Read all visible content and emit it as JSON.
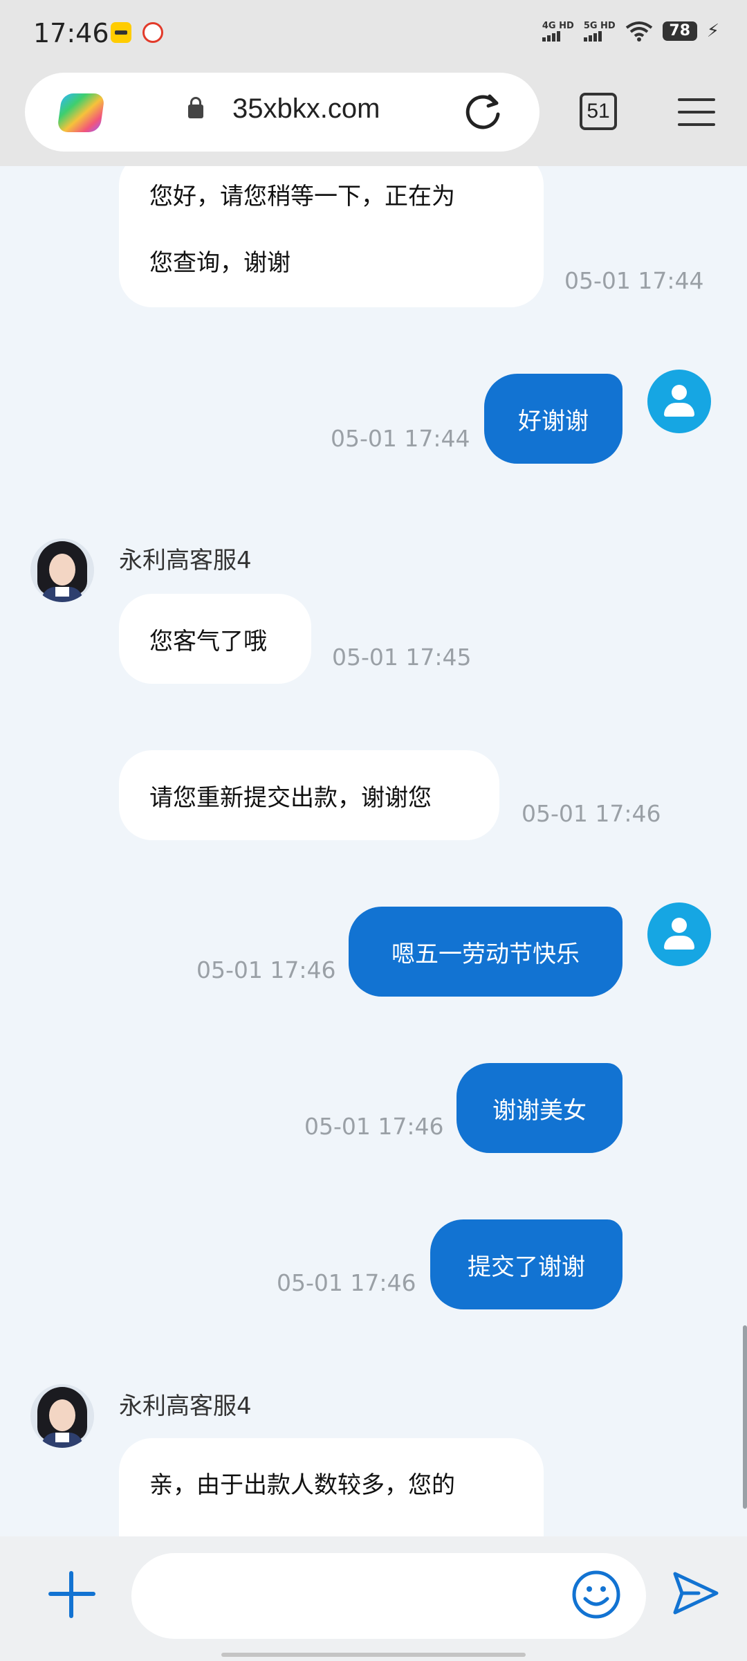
{
  "status_bar": {
    "time": "17:46",
    "network_1": "4G HD",
    "network_2": "5G HD",
    "battery": "78"
  },
  "browser": {
    "url": "35xbkx.com",
    "tab_count": "51",
    "icons": [
      "copilot-icon",
      "lock-icon",
      "reload-icon",
      "menu-icon"
    ]
  },
  "chat": {
    "agent_name": "永利高客服4",
    "messages": [
      {
        "from": "agent",
        "lines": [
          "您好，请您稍等一下，正在为",
          "您查询，谢谢"
        ],
        "time": "05-01 17:44"
      },
      {
        "from": "user",
        "text": "好谢谢",
        "time": "05-01 17:44"
      },
      {
        "from": "agent",
        "sender": "永利高客服4",
        "text": "您客气了哦",
        "time": "05-01 17:45"
      },
      {
        "from": "agent",
        "text": "请您重新提交出款，谢谢您",
        "time": "05-01 17:46"
      },
      {
        "from": "user",
        "text": "嗯五一劳动节快乐",
        "time": "05-01 17:46"
      },
      {
        "from": "user",
        "text": "谢谢美女",
        "time": "05-01 17:46"
      },
      {
        "from": "user",
        "text": "提交了谢谢",
        "time": "05-01 17:46"
      },
      {
        "from": "agent",
        "sender": "永利高客服4",
        "lines": [
          "亲，由于出款人数较多，您的"
        ]
      }
    ]
  },
  "input_bar": {
    "placeholder": "",
    "icons": [
      "plus-icon",
      "emoji-icon",
      "send-icon"
    ],
    "accent_color": "#1273d2"
  }
}
